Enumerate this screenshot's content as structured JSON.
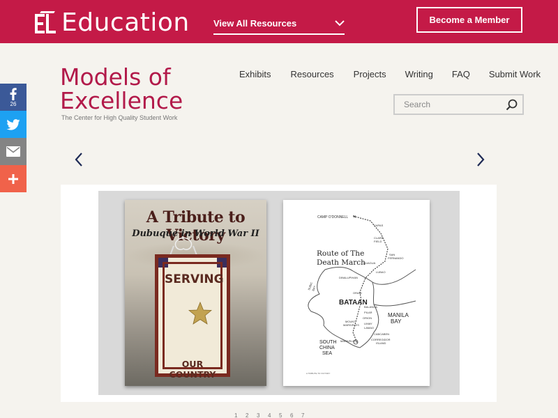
{
  "topbar": {
    "brand_name": "Education",
    "resources_label": "View All Resources",
    "member_button": "Become a Member",
    "bg_color": "#c41a47"
  },
  "logo": {
    "title_line1": "Models of",
    "title_line2": "Excellence",
    "subtitle": "The Center for High Quality Student Work"
  },
  "nav": {
    "items": [
      "Exhibits",
      "Resources",
      "Projects",
      "Writing",
      "FAQ",
      "Submit Work"
    ]
  },
  "search": {
    "placeholder": "Search",
    "icon": "search-icon"
  },
  "social": {
    "facebook_count": "26",
    "icons": [
      "facebook-icon",
      "twitter-icon",
      "email-icon",
      "plus-icon"
    ]
  },
  "carousel": {
    "prev_icon": "chevron-left-icon",
    "next_icon": "chevron-right-icon"
  },
  "slide": {
    "cover": {
      "title": "A Tribute to Victory",
      "subtitle": "Dubuque in World War II",
      "banner_top": "SERVING",
      "banner_bottom": "OUR COUNTRY"
    },
    "map": {
      "heading_line1": "Route of The",
      "heading_line2": "Death March",
      "labels": {
        "camp": "CAMP O'DONNELL",
        "capas": "CAPAS",
        "clark": "CLARK",
        "field": "FIELD",
        "san_fernando": "SAN",
        "san_fernando2": "FERNANDO",
        "guagua": "GUAGUA",
        "lubao": "LUBAO",
        "dinalupihan": "DINALUPIHAN",
        "orani": "ORANI",
        "bataan": "BATAAN",
        "balanga": "BALANGA",
        "pilar": "PILAR",
        "orion": "ORION",
        "manila": "MANILA",
        "bay": "BAY",
        "mount": "MOUNT",
        "mariveles_mt": "MARIVELES",
        "limay": "LIMAY",
        "lamao": "LAMAO",
        "cabcaben": "CABCABEN",
        "corregidor": "CORREGIDOR",
        "island": "ISLAND",
        "mariveles": "MARIVELES",
        "south": "SOUTH",
        "china": "CHINA",
        "sea": "SEA",
        "subic": "SUBIC",
        "bay2": "BAY",
        "footer": "A TRIBUTE TO VICTORY"
      }
    }
  },
  "pagination": {
    "pages": [
      "1",
      "2",
      "3",
      "4",
      "5",
      "6",
      "7"
    ]
  }
}
